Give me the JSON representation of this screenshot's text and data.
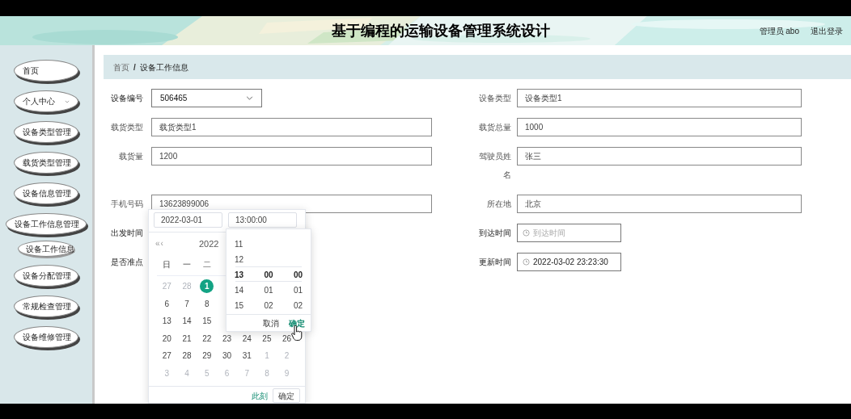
{
  "header": {
    "title": "基于编程的运输设备管理系统设计",
    "user": "管理员 abo",
    "logout": "退出登录"
  },
  "sidebar": {
    "items": [
      {
        "label": "首页",
        "kind": "menu",
        "has_submenu": false
      },
      {
        "label": "个人中心",
        "kind": "menu",
        "has_submenu": true
      },
      {
        "label": "设备类型管理",
        "kind": "menu",
        "has_submenu": false
      },
      {
        "label": "载货类型管理",
        "kind": "menu",
        "has_submenu": false
      },
      {
        "label": "设备信息管理",
        "kind": "menu",
        "has_submenu": false
      },
      {
        "label": "设备工作信息管理",
        "kind": "menu",
        "has_submenu": false
      },
      {
        "label": "设备工作信息",
        "kind": "submenu",
        "has_submenu": false
      },
      {
        "label": "设备分配管理",
        "kind": "menu",
        "has_submenu": false
      },
      {
        "label": "常规检查管理",
        "kind": "menu",
        "has_submenu": false
      },
      {
        "label": "设备维修管理",
        "kind": "menu",
        "has_submenu": false
      }
    ]
  },
  "breadcrumb": {
    "separator": "/",
    "items": [
      {
        "label": "首页",
        "current": false
      },
      {
        "label": "设备工作信息",
        "current": true
      }
    ]
  },
  "form": {
    "rows": [
      [
        {
          "label": "设备编号",
          "kind": "select",
          "value": "506465",
          "readonly": false
        },
        {
          "label": "设备类型",
          "kind": "input",
          "value": "设备类型1",
          "readonly": true
        }
      ],
      [
        {
          "label": "载货类型",
          "kind": "input",
          "value": "载货类型1",
          "readonly": true
        },
        {
          "label": "载货总量",
          "kind": "input",
          "value": "1000",
          "readonly": true
        }
      ],
      [
        {
          "label": "载货量",
          "kind": "input",
          "value": "1200",
          "readonly": true
        },
        {
          "label": "驾驶员姓名",
          "kind": "input",
          "value": "张三",
          "readonly": true
        }
      ],
      [
        {
          "label": "手机号码",
          "kind": "input",
          "value": "13623899006",
          "readonly": true
        },
        {
          "label": "所在地",
          "kind": "input",
          "value": "北京",
          "readonly": true
        }
      ],
      [
        {
          "label": "出发时间",
          "kind": "label",
          "readonly": false
        },
        {
          "label": "到达时间",
          "kind": "datetime",
          "placeholder": "到达时间",
          "readonly": false
        }
      ],
      [
        {
          "label": "是否准点",
          "kind": "label",
          "readonly": false
        },
        {
          "label": "更新时间",
          "kind": "datetime",
          "value": "2022-03-02 23:23:30",
          "readonly": false
        }
      ]
    ]
  },
  "date_picker": {
    "date_value": "2022-03-01",
    "time_value": "13:00:00",
    "prev_year": "«",
    "prev_month": "‹",
    "year": "2022",
    "weekdays": [
      "日",
      "一",
      "二"
    ],
    "weeks": [
      [
        {
          "day": "27",
          "muted": true,
          "selected": false
        },
        {
          "day": "28",
          "muted": true,
          "selected": false
        },
        {
          "day": "1",
          "muted": false,
          "selected": true
        }
      ],
      [
        {
          "day": "6",
          "muted": false,
          "selected": false
        },
        {
          "day": "7",
          "muted": false,
          "selected": false
        },
        {
          "day": "8",
          "muted": false,
          "selected": false
        }
      ],
      [
        {
          "day": "13",
          "muted": false,
          "selected": false
        },
        {
          "day": "14",
          "muted": false,
          "selected": false
        },
        {
          "day": "15",
          "muted": false,
          "selected": false
        }
      ],
      [
        {
          "day": "20",
          "muted": false,
          "selected": false
        },
        {
          "day": "21",
          "muted": false,
          "selected": false
        },
        {
          "day": "22",
          "muted": false,
          "selected": false
        },
        {
          "day": "23",
          "muted": false,
          "selected": false
        },
        {
          "day": "24",
          "muted": false,
          "selected": false
        },
        {
          "day": "25",
          "muted": false,
          "selected": false
        },
        {
          "day": "26",
          "muted": false,
          "selected": false
        }
      ],
      [
        {
          "day": "27",
          "muted": false,
          "selected": false
        },
        {
          "day": "28",
          "muted": false,
          "selected": false
        },
        {
          "day": "29",
          "muted": false,
          "selected": false
        },
        {
          "day": "30",
          "muted": false,
          "selected": false
        },
        {
          "day": "31",
          "muted": false,
          "selected": false
        },
        {
          "day": "1",
          "muted": true,
          "selected": false
        },
        {
          "day": "2",
          "muted": true,
          "selected": false
        }
      ],
      [
        {
          "day": "3",
          "muted": true,
          "selected": false
        },
        {
          "day": "4",
          "muted": true,
          "selected": false
        },
        {
          "day": "5",
          "muted": true,
          "selected": false
        },
        {
          "day": "6",
          "muted": true,
          "selected": false
        },
        {
          "day": "7",
          "muted": true,
          "selected": false
        },
        {
          "day": "8",
          "muted": true,
          "selected": false
        },
        {
          "day": "9",
          "muted": true,
          "selected": false
        }
      ]
    ],
    "now_link": "此刻",
    "confirm": "确定"
  },
  "time_panel": {
    "columns": [
      {
        "items": [
          {
            "text": "11",
            "selected": false
          },
          {
            "text": "12",
            "selected": false
          },
          {
            "text": "13",
            "selected": true
          },
          {
            "text": "14",
            "selected": false
          },
          {
            "text": "15",
            "selected": false
          }
        ]
      },
      {
        "items": [
          {
            "text": "00",
            "selected": true
          },
          {
            "text": "01",
            "selected": false
          },
          {
            "text": "02",
            "selected": false
          }
        ]
      },
      {
        "items": [
          {
            "text": "00",
            "selected": true
          },
          {
            "text": "01",
            "selected": false
          },
          {
            "text": "02",
            "selected": false
          }
        ]
      }
    ],
    "cancel": "取消",
    "confirm": "确定"
  }
}
